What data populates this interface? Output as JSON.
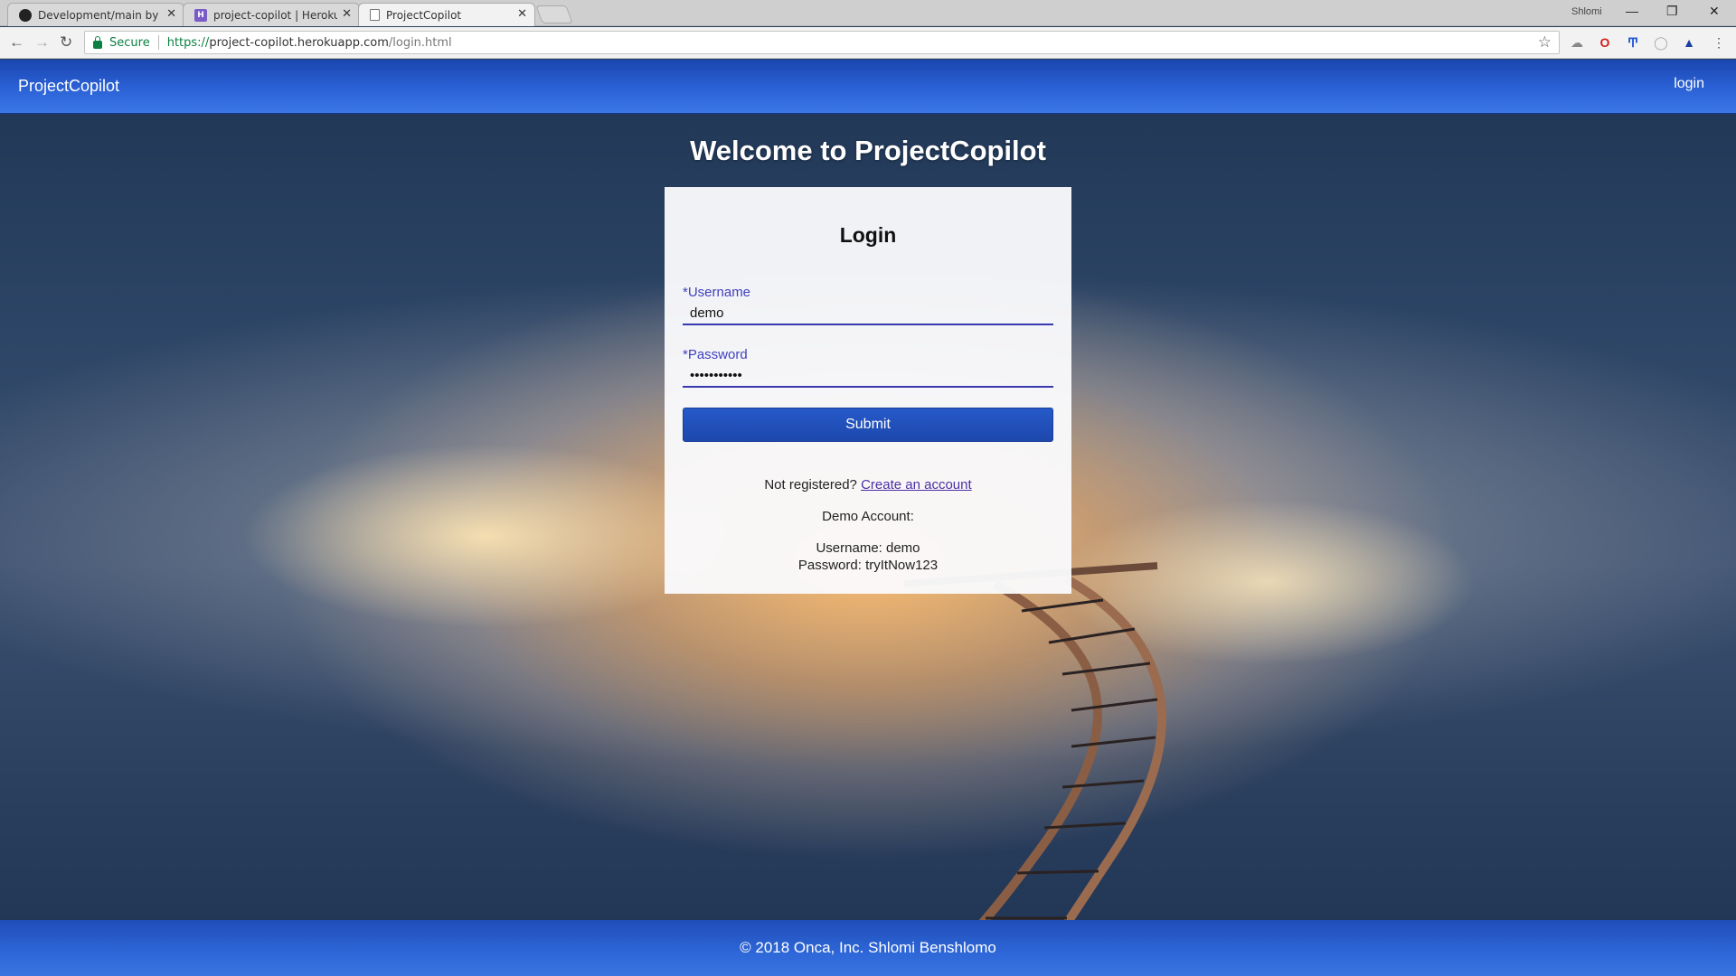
{
  "browser": {
    "tabs": [
      {
        "title": "Development/main by sh",
        "favicon": "github-icon"
      },
      {
        "title": "project-copilot | Heroku",
        "favicon": "heroku-icon"
      },
      {
        "title": "ProjectCopilot",
        "favicon": "document-icon",
        "active": true
      }
    ],
    "profile_name": "Shlomi",
    "address": {
      "secure_label": "Secure",
      "url_prefix": "https://",
      "url_host": "project-copilot.herokuapp.com",
      "url_path": "/login.html"
    },
    "extensions": [
      "cast-icon",
      "opera-icon",
      "tools-icon",
      "circle-icon",
      "triangle-icon",
      "menu-icon"
    ]
  },
  "navbar": {
    "brand": "ProjectCopilot",
    "login_link": "login",
    "color": "#2b62d6"
  },
  "welcome_title": "Welcome to ProjectCopilot",
  "login_form": {
    "title": "Login",
    "username_label": "*Username",
    "username_value": "demo",
    "password_label": "*Password",
    "password_value": "tryItNow123",
    "submit_label": "Submit",
    "not_registered_text": "Not registered?",
    "create_account_link": "Create an account",
    "demo_heading": "Demo Account:",
    "demo_username": "Username: demo",
    "demo_password": "Password: tryItNow123",
    "accent_color": "#3838b0"
  },
  "footer": {
    "text": "© 2018 Onca, Inc. Shlomi Benshlomo"
  }
}
